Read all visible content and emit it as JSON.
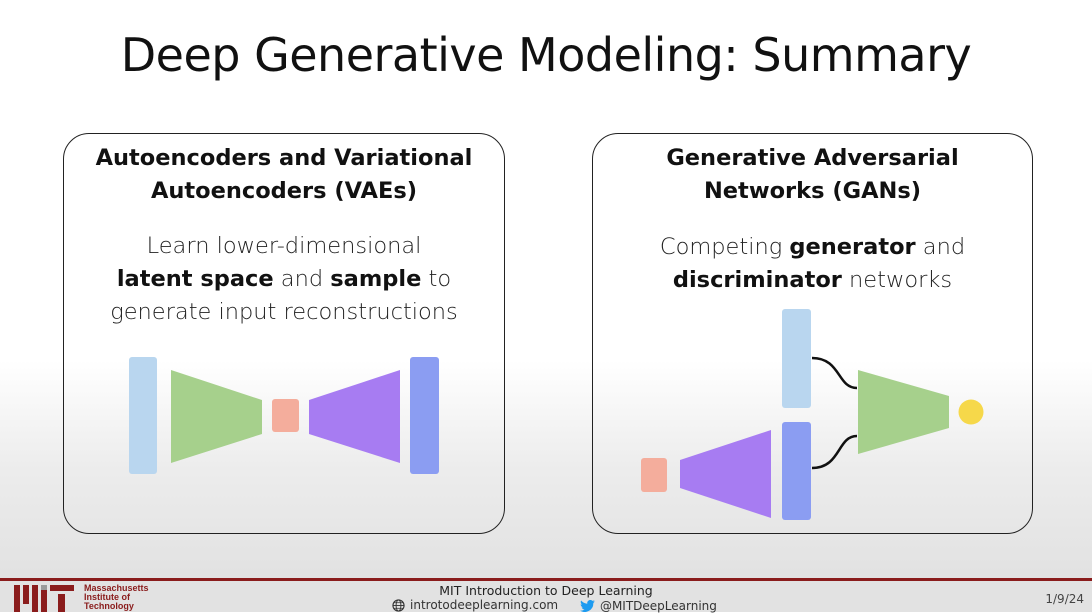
{
  "slide": {
    "title": "Deep Generative Modeling: Summary"
  },
  "panels": {
    "vae": {
      "heading": [
        "Autoencoders and Variational",
        "Autoencoders (VAEs)"
      ],
      "body": {
        "line1": "Learn lower-dimensional",
        "line2_bold1": "latent space",
        "line2_mid": " and ",
        "line2_bold2": "sample",
        "line2_end": " to",
        "line3": "generate input reconstructions"
      }
    },
    "gan": {
      "heading": [
        "Generative Adversarial",
        "Networks (GANs)"
      ],
      "body": {
        "line1_start": "Competing ",
        "line1_bold": "generator",
        "line1_end": " and",
        "line2_bold": "discriminator",
        "line2_end": " networks"
      }
    }
  },
  "colors": {
    "input_block": "#b9d6ef",
    "encoder": "#a6d08c",
    "latent": "#f4ad9c",
    "decoder": "#a77cf2",
    "output_block": "#8b9df2",
    "discriminator_output": "#f6d84a",
    "brand_red": "#8a1c1c"
  },
  "footer": {
    "institution": [
      "Massachusetts",
      "Institute of",
      "Technology"
    ],
    "course_title": "MIT Introduction to Deep Learning",
    "website": "introtodeeplearning.com",
    "twitter": "@MITDeepLearning",
    "date": "1/9/24",
    "icons": [
      "globe-icon",
      "twitter-bird-icon",
      "mit-logo"
    ]
  }
}
